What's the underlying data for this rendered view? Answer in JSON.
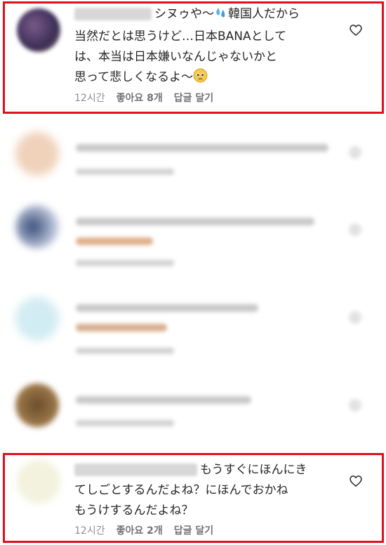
{
  "comments": [
    {
      "text_line1": "シヌゥや〜",
      "text_line1b": "韓国人だから",
      "text_line2": "当然だとは思うけど…日本BANAとして",
      "text_line3": "は、本当は日本嫌いなんじゃないかと",
      "text_line4": "思って悲しくなるよ〜",
      "time": "12시간",
      "likes": "좋아요 8개",
      "reply": "답글 달기"
    },
    {
      "text_line1": "もうすぐにほんにき",
      "text_line2": "てしごとするんだよね？にほんでおかね",
      "text_line3": "もうけするんだよね？",
      "time": "12시간",
      "likes": "좋아요 2개",
      "reply": "답글 달기"
    }
  ],
  "colors": {
    "highlight": "#e0101e",
    "text": "#262626",
    "meta": "#8e8e8e"
  },
  "icons": [
    "heart-icon",
    "droplets-emoji",
    "pleading-face-emoji"
  ]
}
